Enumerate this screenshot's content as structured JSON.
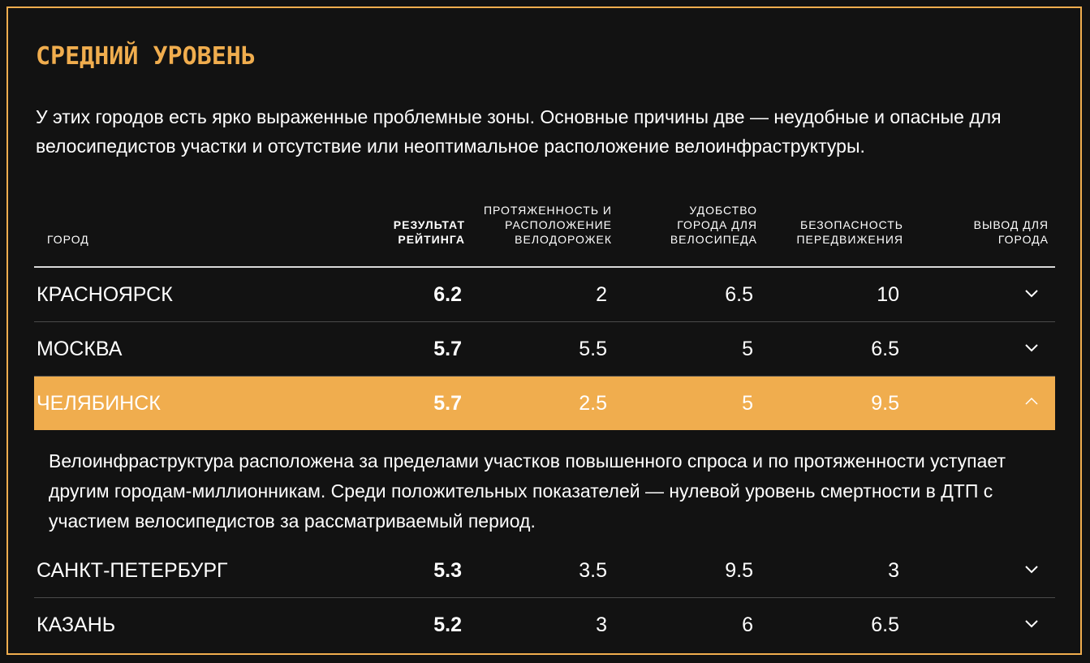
{
  "section": {
    "title": "СРЕДНИЙ УРОВЕНЬ",
    "intro": "У этих городов есть ярко выраженные проблемные зоны. Основные причины две — неудобные и опасные для велосипедистов участки и отсутствие или неоптимальное расположение велоинфраструктуры."
  },
  "table": {
    "headers": {
      "city": "ГОРОД",
      "score": "РЕЗУЛЬТАТ РЕЙТИНГА",
      "lanes": "ПРОТЯЖЕННОСТЬ И РАСПОЛОЖЕНИЕ ВЕЛОДОРОЖЕК",
      "comfort": "УДОБСТВО ГОРОДА ДЛЯ ВЕЛОСИПЕДА",
      "safety": "БЕЗОПАСНОСТЬ ПЕРЕДВИЖЕНИЯ",
      "conclusion": "ВЫВОД ДЛЯ ГОРОДА"
    },
    "rows": [
      {
        "city": "КРАСНОЯРСК",
        "score": "6.2",
        "lanes": "2",
        "comfort": "6.5",
        "safety": "10",
        "expanded": false
      },
      {
        "city": "МОСКВА",
        "score": "5.7",
        "lanes": "5.5",
        "comfort": "5",
        "safety": "6.5",
        "expanded": false
      },
      {
        "city": "ЧЕЛЯБИНСК",
        "score": "5.7",
        "lanes": "2.5",
        "comfort": "5",
        "safety": "9.5",
        "expanded": true,
        "conclusion": "Велоинфраструктура расположена за пределами участков повышенного спроса и по протяженности уступает другим городам-миллионникам. Среди положительных показателей — нулевой уровень смертности в ДТП с участием велосипедистов за рассматриваемый период."
      },
      {
        "city": "САНКТ-ПЕТЕРБУРГ",
        "score": "5.3",
        "lanes": "3.5",
        "comfort": "9.5",
        "safety": "3",
        "expanded": false
      },
      {
        "city": "КАЗАНЬ",
        "score": "5.2",
        "lanes": "3",
        "comfort": "6",
        "safety": "6.5",
        "expanded": false
      }
    ]
  },
  "colors": {
    "accent": "#f0ad4e",
    "background": "#121212",
    "text": "#ffffff"
  },
  "icons": {
    "collapsed": "chevron-down-icon",
    "expanded": "chevron-up-icon"
  }
}
